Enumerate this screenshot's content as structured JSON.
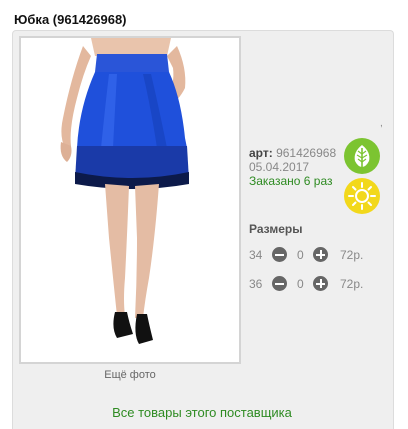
{
  "product": {
    "title": "Юбка (961426968)"
  },
  "gallery": {
    "more_photo_label": "Ещё фото"
  },
  "info": {
    "art_label": "арт:",
    "art_value": "961426968",
    "date": "05.04.2017",
    "ordered": "Заказано 6 раз"
  },
  "badges": {
    "leaf": {
      "icon": "leaf-icon",
      "color": "#7cc431"
    },
    "sun": {
      "icon": "sun-icon",
      "color": "#f2d81b"
    }
  },
  "sizes": {
    "title": "Размеры",
    "rows": [
      {
        "size": "34",
        "qty": "0",
        "price": "72р."
      },
      {
        "size": "36",
        "qty": "0",
        "price": "72р."
      }
    ]
  },
  "footer": {
    "all_goods_link": "Все товары этого поставщика"
  },
  "misc": {
    "tick": ","
  },
  "colors": {
    "skirt": "#1e4fd6",
    "link_green": "#2e8b22"
  }
}
